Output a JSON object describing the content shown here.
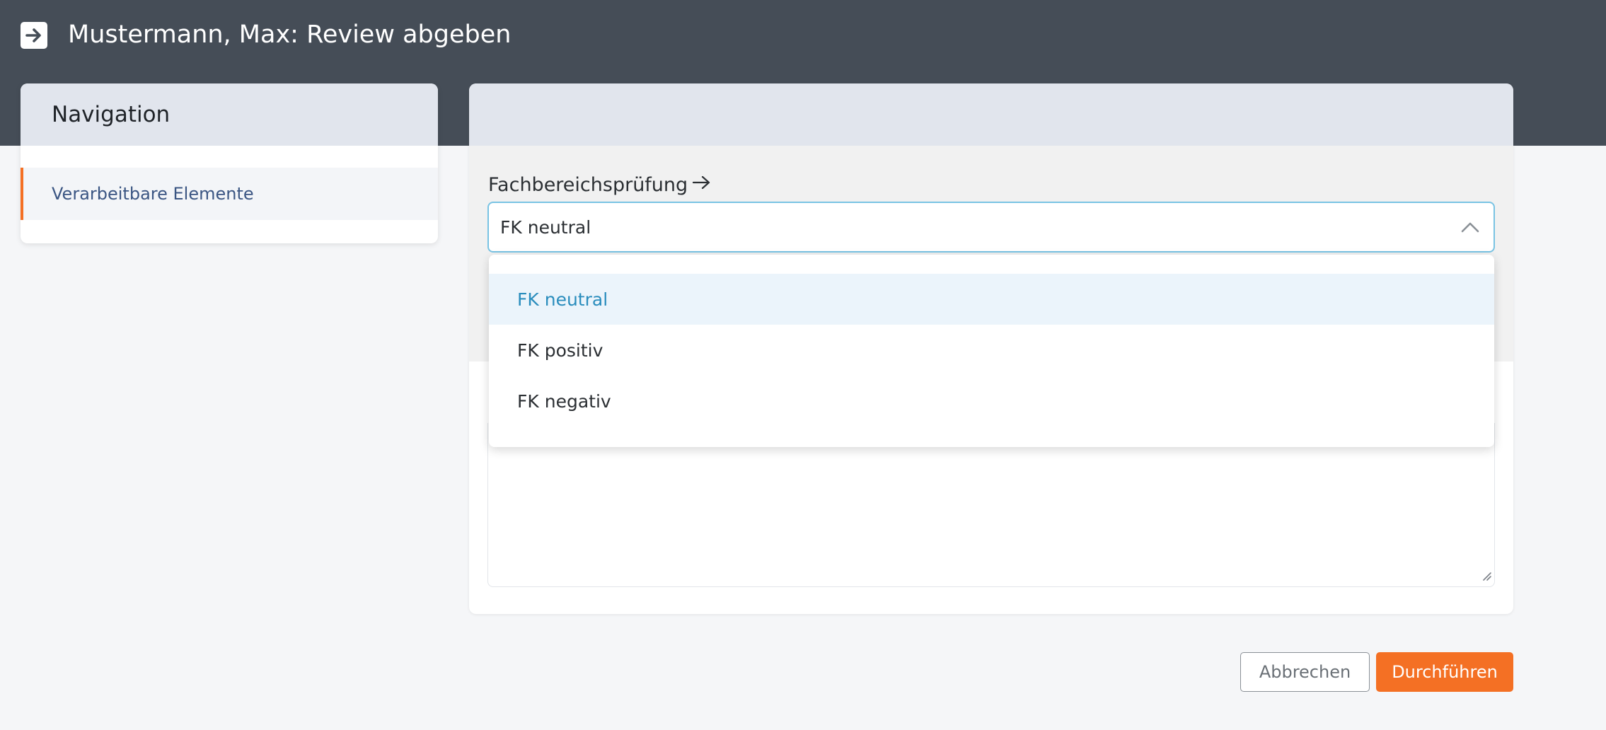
{
  "header": {
    "title": "Mustermann, Max: Review abgeben",
    "icon": "arrow-right-square-icon"
  },
  "navigation": {
    "title": "Navigation",
    "items": [
      {
        "label": "Verarbeitbare Elemente",
        "active": true
      }
    ]
  },
  "form": {
    "field_label": "Fachbereichsprüfung",
    "select": {
      "value": "FK neutral",
      "expanded": true,
      "options": [
        {
          "label": "FK neutral",
          "selected": true
        },
        {
          "label": "FK positiv",
          "selected": false
        },
        {
          "label": "FK negativ",
          "selected": false
        }
      ]
    }
  },
  "actions": {
    "cancel_label": "Abbrechen",
    "submit_label": "Durchführen"
  },
  "colors": {
    "topbar": "#454d57",
    "accent": "#f47024",
    "link": "#3b5683",
    "selected_option": "#2a8dbd",
    "focus_border": "#79c3e3"
  }
}
